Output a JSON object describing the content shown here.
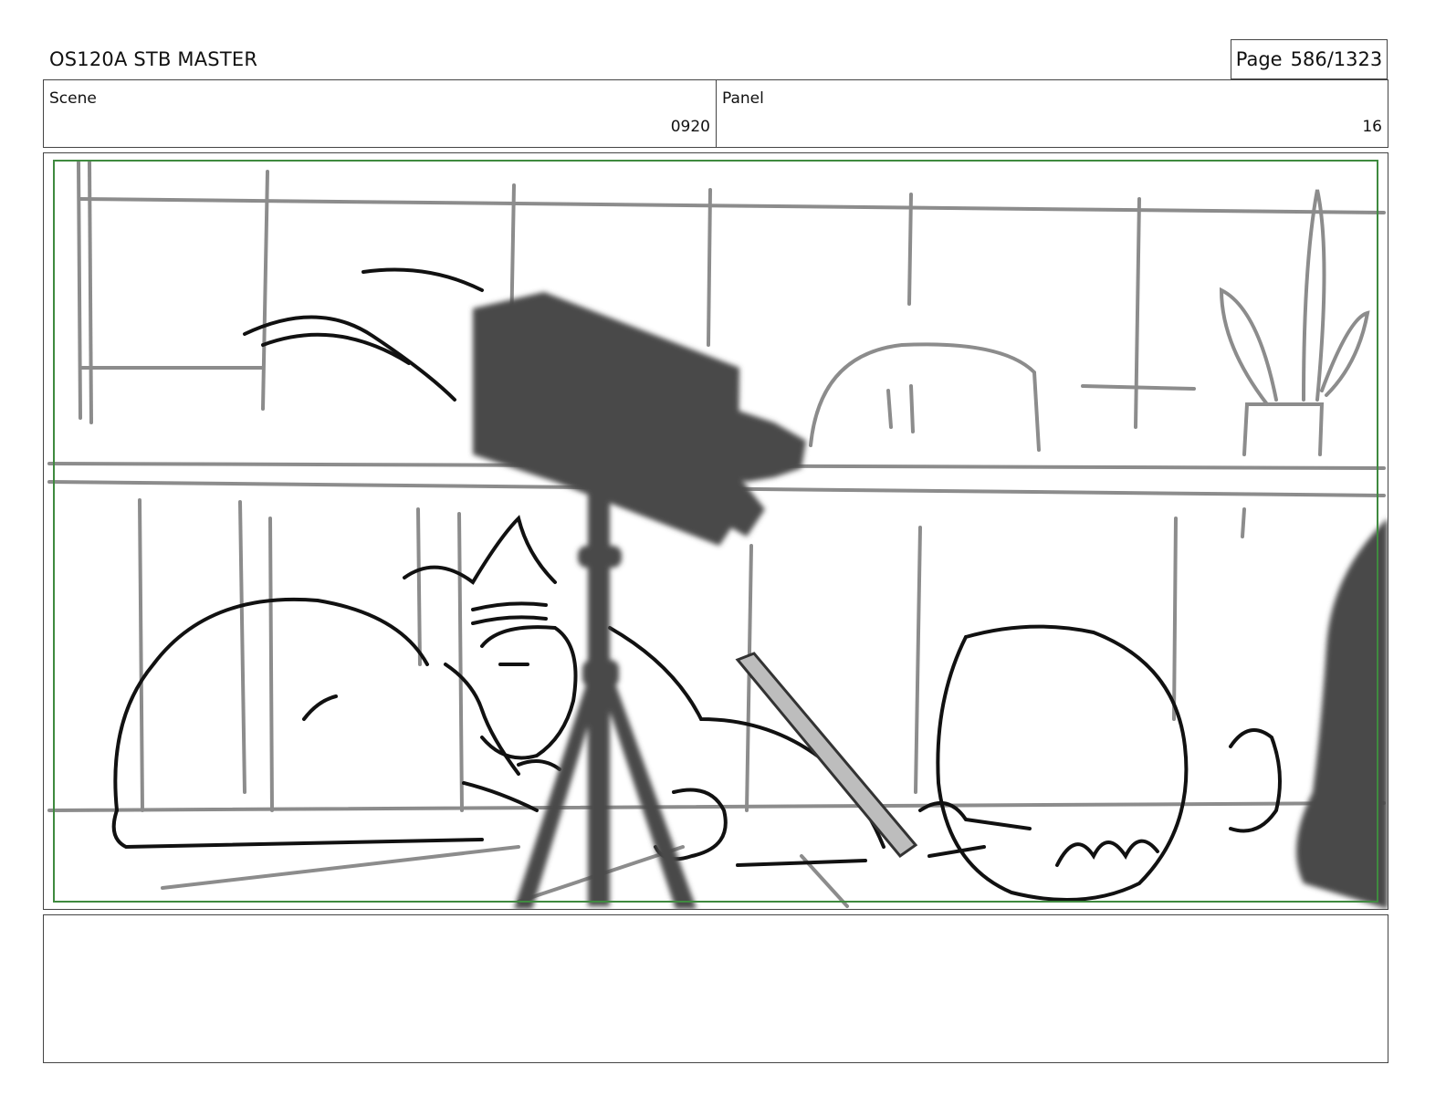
{
  "header": {
    "title": "OS120A STB MASTER",
    "page_label": "Page",
    "page_number": "586/1323"
  },
  "scene": {
    "label": "Scene",
    "value": "0920"
  },
  "panel": {
    "label": "Panel",
    "value": "16"
  },
  "colors": {
    "safe_frame": "#3f8a3f",
    "camera": "#4a4a4a",
    "background_lines": "#8c8c8c"
  },
  "notes": {
    "text": ""
  }
}
